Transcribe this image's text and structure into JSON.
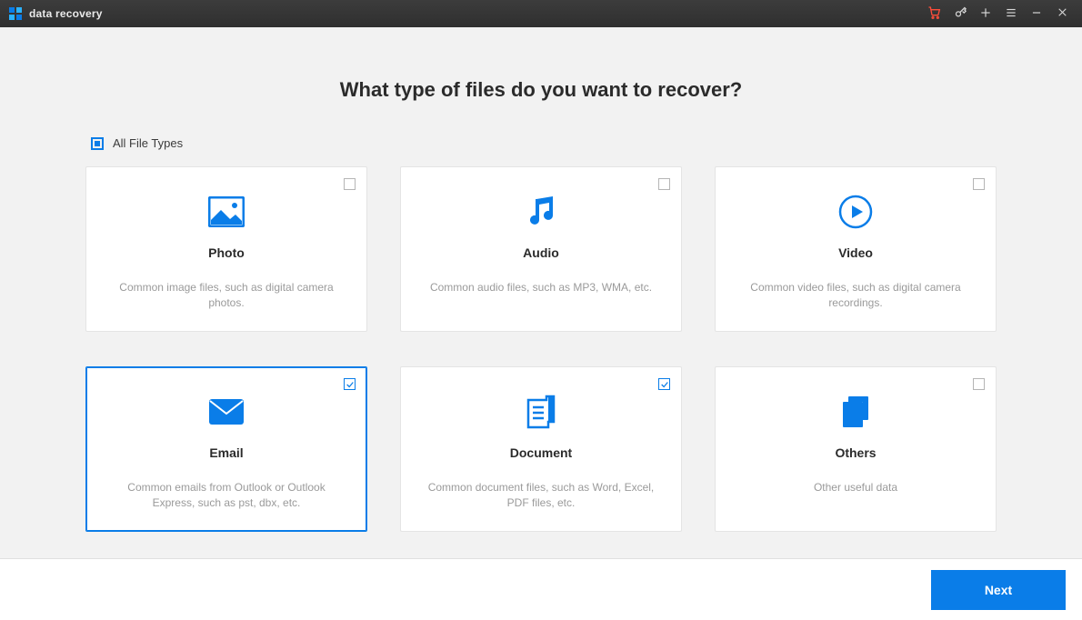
{
  "app": {
    "name": "data recovery"
  },
  "question": "What type of files do you want to recover?",
  "all_types": {
    "label": "All File Types",
    "state": "indeterminate"
  },
  "cards": [
    {
      "id": "photo",
      "title": "Photo",
      "desc": "Common image files, such as digital camera photos.",
      "checked": false
    },
    {
      "id": "audio",
      "title": "Audio",
      "desc": "Common audio files, such as MP3, WMA, etc.",
      "checked": false
    },
    {
      "id": "video",
      "title": "Video",
      "desc": "Common video files, such as digital camera recordings.",
      "checked": false
    },
    {
      "id": "email",
      "title": "Email",
      "desc": "Common emails from Outlook or Outlook Express, such as pst, dbx, etc.",
      "checked": true,
      "selected": true
    },
    {
      "id": "document",
      "title": "Document",
      "desc": "Common document files, such as Word, Excel, PDF files, etc.",
      "checked": true
    },
    {
      "id": "others",
      "title": "Others",
      "desc": "Other useful data",
      "checked": false
    }
  ],
  "footer": {
    "next": "Next"
  },
  "colors": {
    "accent": "#0a7de8",
    "danger": "#ff4d3a"
  }
}
